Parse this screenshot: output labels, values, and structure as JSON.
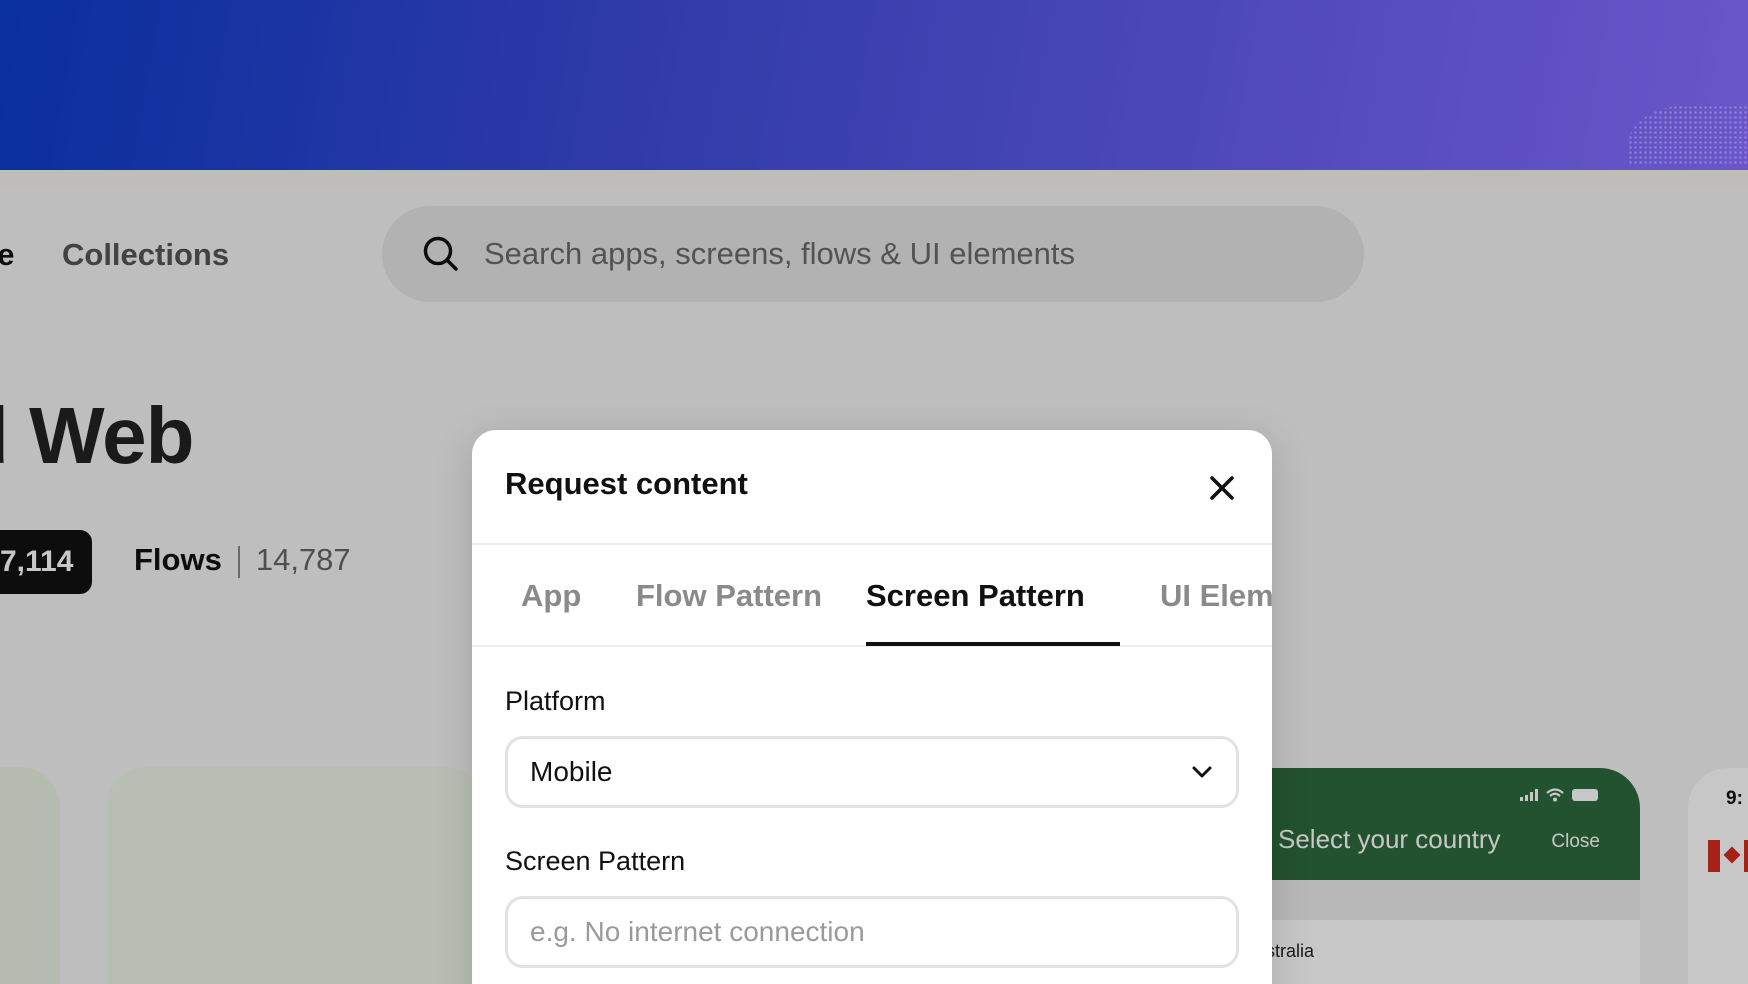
{
  "header": {
    "nav_partial": "se",
    "nav_collections": "Collections",
    "search_placeholder": "Search apps, screens, flows & UI elements"
  },
  "hero": {
    "title_partial": "d  Web"
  },
  "stats": {
    "active_count_partial": "7,114",
    "flows_label": "Flows",
    "flows_count": "14,787"
  },
  "preview": {
    "phone_title": "Select your country",
    "phone_close": "Close",
    "phone_row": "stralia",
    "phone2_time": "9:"
  },
  "modal": {
    "title": "Request content",
    "tabs": [
      {
        "label": "App"
      },
      {
        "label": "Flow Pattern"
      },
      {
        "label": "Screen Pattern"
      },
      {
        "label": "UI Elem"
      }
    ],
    "active_tab": "Screen Pattern",
    "platform": {
      "label": "Platform",
      "selected": "Mobile"
    },
    "screen_pattern": {
      "label": "Screen Pattern",
      "placeholder": "e.g. No internet connection"
    }
  },
  "colors": {
    "banner_start": "#0a2f9e",
    "banner_end": "#6a56c9",
    "phone_header": "#2e6a3e",
    "accent": "#111111"
  }
}
